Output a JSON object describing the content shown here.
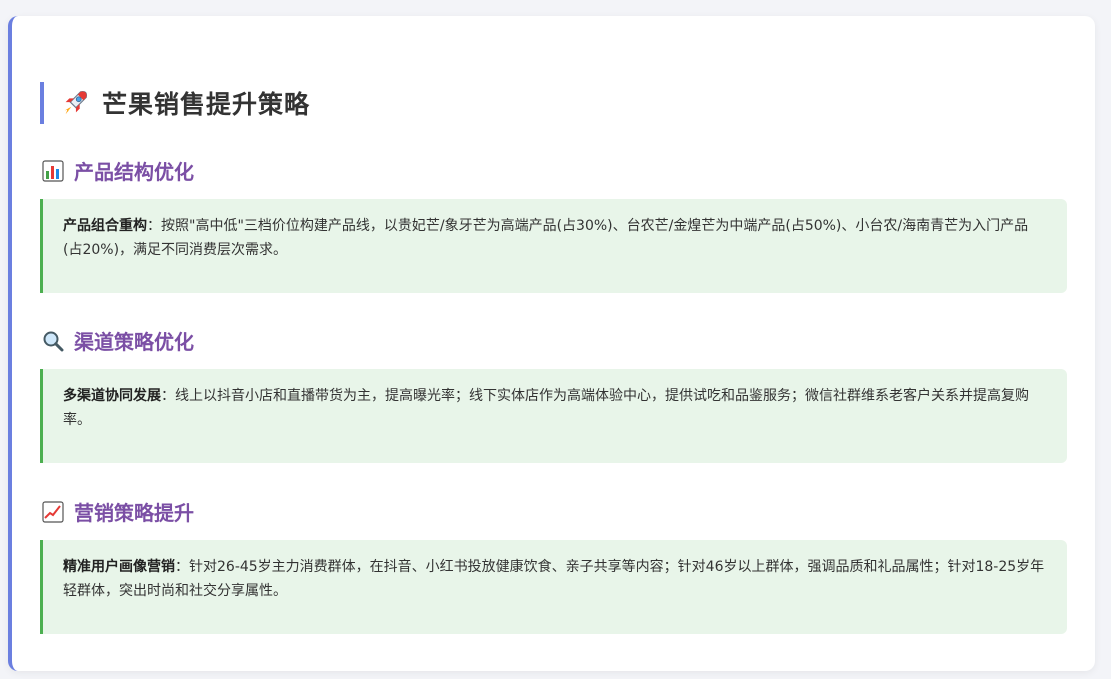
{
  "page": {
    "title": "芒果销售提升策略",
    "title_icon": "rocket-icon"
  },
  "sections": [
    {
      "icon": "bar-chart-icon",
      "heading": "产品结构优化",
      "label": "产品组合重构",
      "text": "：按照\"高中低\"三档价位构建产品线，以贵妃芒/象牙芒为高端产品(占30%)、台农芒/金煌芒为中端产品(占50%)、小台农/海南青芒为入门产品(占20%)，满足不同消费层次需求。"
    },
    {
      "icon": "magnifier-icon",
      "heading": "渠道策略优化",
      "label": "多渠道协同发展",
      "text": "：线上以抖音小店和直播带货为主，提高曝光率；线下实体店作为高端体验中心，提供试吃和品鉴服务；微信社群维系老客户关系并提高复购率。"
    },
    {
      "icon": "trend-up-icon",
      "heading": "营销策略提升",
      "label": "精准用户画像营销",
      "text": "：针对26-45岁主力消费群体，在抖音、小红书投放健康饮食、亲子共享等内容；针对46岁以上群体，强调品质和礼品属性；针对18-25岁年轻群体，突出时尚和社交分享属性。"
    }
  ]
}
